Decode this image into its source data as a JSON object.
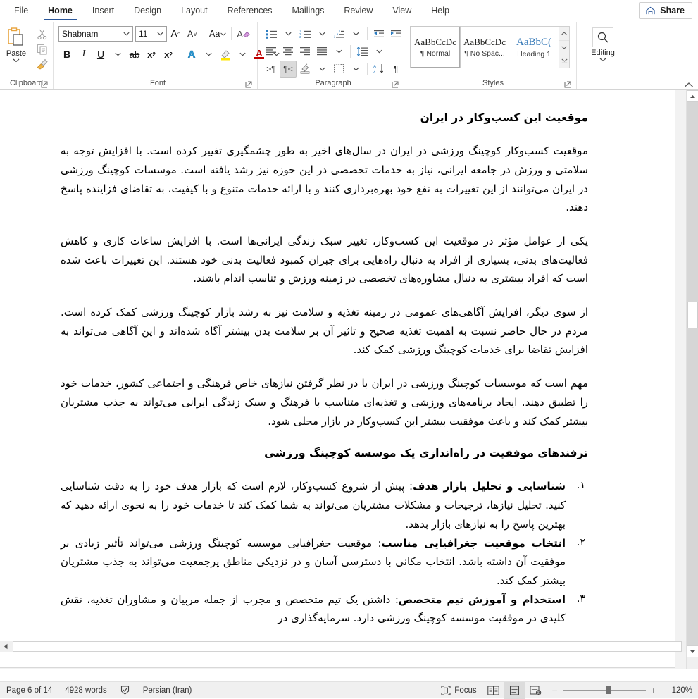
{
  "tabs": [
    {
      "label": "File",
      "active": false
    },
    {
      "label": "Home",
      "active": true
    },
    {
      "label": "Insert",
      "active": false
    },
    {
      "label": "Design",
      "active": false
    },
    {
      "label": "Layout",
      "active": false
    },
    {
      "label": "References",
      "active": false
    },
    {
      "label": "Mailings",
      "active": false
    },
    {
      "label": "Review",
      "active": false
    },
    {
      "label": "View",
      "active": false
    },
    {
      "label": "Help",
      "active": false
    }
  ],
  "share": {
    "label": "Share",
    "icon": "share-icon"
  },
  "ribbon": {
    "clipboard": {
      "group_label": "Clipboard",
      "paste_label": "Paste",
      "items": [
        "paste-icon",
        "cut-scissors-icon",
        "copy-icon",
        "format-painter-icon"
      ]
    },
    "font": {
      "group_label": "Font",
      "font_name": "Shabnam",
      "font_size": "11",
      "buttons": [
        "grow-font-icon",
        "shrink-font-icon",
        "change-case-icon",
        "clear-formatting-icon",
        "bold-icon",
        "italic-icon",
        "underline-icon",
        "strikethrough-icon",
        "subscript-icon",
        "superscript-icon",
        "text-effects-icon",
        "text-highlight-icon",
        "font-color-icon"
      ],
      "bold_glyph": "B",
      "italic_glyph": "I",
      "underline_glyph": "U",
      "strike_glyph": "ab",
      "subscript_glyph": "x",
      "superscript_glyph": "x",
      "case_glyph": "Aa",
      "grow_glyph": "A",
      "shrink_glyph": "A",
      "effects_glyph": "A",
      "highlight_glyph": "A",
      "color_glyph": "A"
    },
    "paragraph": {
      "group_label": "Paragraph",
      "buttons": [
        "bullet-list-icon",
        "numbered-list-icon",
        "multilevel-list-icon",
        "decrease-indent-icon",
        "increase-indent-icon",
        "align-left-icon",
        "align-center-icon",
        "align-right-icon",
        "justify-icon",
        "line-spacing-icon",
        "ltr-text-direction-icon",
        "rtl-text-direction-icon",
        "shading-icon",
        "borders-icon",
        "sort-icon",
        "show-marks-icon"
      ],
      "rtl_active": true
    },
    "styles": {
      "group_label": "Styles",
      "gallery": [
        {
          "preview": "AaBbCcDc",
          "name": "¶ Normal",
          "selected": true,
          "heading": false
        },
        {
          "preview": "AaBbCcDc",
          "name": "¶ No Spac...",
          "selected": false,
          "heading": false
        },
        {
          "preview": "AaBbC(",
          "name": "Heading 1",
          "selected": false,
          "heading": true
        }
      ]
    },
    "editing": {
      "group_label": "Editing",
      "label": "Editing",
      "icon": "search-magnifier-icon"
    }
  },
  "document": {
    "heading1": "موقعیت این کسب‌وکار در ایران",
    "paragraphs": [
      "موقعیت کسب‌وکار کوچینگ ورزشی در ایران در سال‌های اخیر به طور چشمگیری تغییر کرده است. با افزایش توجه به سلامتی و ورزش در جامعه ایرانی، نیاز به خدمات تخصصی در این حوزه نیز رشد یافته است. موسسات کوچینگ ورزشی در ایران می‌توانند از این تغییرات به نفع خود بهره‌برداری کنند و با ارائه خدمات متنوع و با کیفیت، به تقاضای فزاینده پاسخ دهند.",
      "یکی از عوامل مؤثر در موقعیت این کسب‌وکار، تغییر سبک زندگی ایرانی‌ها است. با افزایش ساعات کاری و کاهش فعالیت‌های بدنی، بسیاری از افراد به دنبال راه‌هایی برای جبران کمبود فعالیت بدنی خود هستند. این تغییرات باعث شده است که افراد بیشتری به دنبال مشاوره‌های تخصصی در زمینه ورزش و تناسب اندام باشند.",
      "از سوی دیگر، افزایش آگاهی‌های عمومی در زمینه تغذیه و سلامت نیز به رشد بازار کوچینگ ورزشی کمک کرده است. مردم در حال حاضر نسبت به اهمیت تغذیه صحیح و تاثیر آن بر سلامت بدن بیشتر آگاه شده‌اند و این آگاهی می‌تواند به افزایش تقاضا برای خدمات کوچینگ ورزشی کمک کند.",
      "مهم است که موسسات کوچینگ ورزشی در ایران با در نظر گرفتن نیازهای خاص فرهنگی و اجتماعی کشور، خدمات خود را تطبیق دهند. ایجاد برنامه‌های ورزشی و تغذیه‌ای متناسب با فرهنگ و سبک زندگی ایرانی می‌تواند به جذب مشتریان بیشتر کمک کند و باعث موفقیت بیشتر این کسب‌وکار در بازار محلی شود."
    ],
    "heading2": "ترفندهای موفقیت در راه‌اندازی یک موسسه کوچینگ ورزشی",
    "list": [
      {
        "num": "۱.",
        "strong": "شناسایی و تحلیل بازار هدف",
        "text": ": پیش از شروع کسب‌وکار، لازم است که بازار هدف خود را به دقت شناسایی کنید. تحلیل نیازها، ترجیحات و مشکلات مشتریان می‌تواند به شما کمک کند تا خدمات خود را به نحوی ارائه دهید که بهترین پاسخ را به نیازهای بازار بدهد."
      },
      {
        "num": "۲.",
        "strong": "انتخاب موقعیت جغرافیایی مناسب",
        "text": ": موقعیت جغرافیایی موسسه کوچینگ ورزشی می‌تواند تأثیر زیادی بر موفقیت آن داشته باشد. انتخاب مکانی با دسترسی آسان و در نزدیکی مناطق پرجمعیت می‌تواند به جذب مشتریان بیشتر کمک کند."
      },
      {
        "num": "۳.",
        "strong": "استخدام و آموزش تیم متخصص",
        "text": ": داشتن یک تیم متخصص و مجرب از جمله مربیان و مشاوران تغذیه، نقش کلیدی در موفقیت موسسه کوچینگ ورزشی دارد. سرمایه‌گذاری در"
      }
    ]
  },
  "statusbar": {
    "page": "Page 6 of 14",
    "words": "4928 words",
    "proofing_icon": "proofing-errors-icon",
    "language": "Persian (Iran)",
    "focus": "Focus",
    "focus_icon": "focus-mode-icon",
    "views": [
      {
        "name": "read-mode-view",
        "active": false
      },
      {
        "name": "print-layout-view",
        "active": true
      },
      {
        "name": "web-layout-view",
        "active": false
      }
    ],
    "zoom_out": "−",
    "zoom_in": "+",
    "zoom": "120%"
  },
  "colors": {
    "accent": "#2b579a",
    "heading_blue": "#2e74b5",
    "ribbon_bg": "#ffffff",
    "doc_bg": "#f2f2f2",
    "status_bg": "#f0f0f0"
  }
}
